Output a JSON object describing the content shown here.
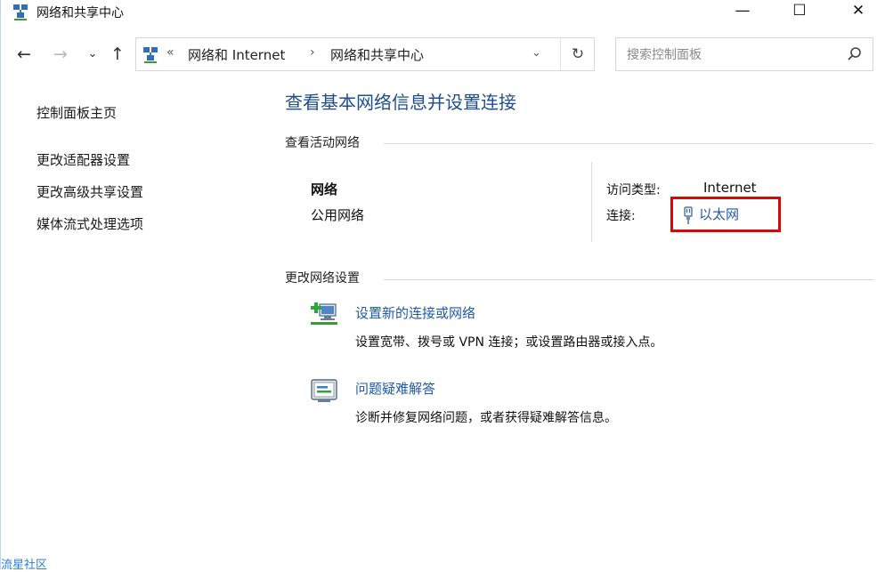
{
  "window": {
    "title": "网络和共享中心",
    "minimize_glyph": "—",
    "maximize_glyph": "☐",
    "close_glyph": "✕"
  },
  "nav": {
    "back": "←",
    "forward": "→",
    "recent": "⌄",
    "up": "↑"
  },
  "address": {
    "overflow": "«",
    "crumbs": [
      "网络和 Internet",
      "网络和共享中心"
    ],
    "separator": "›",
    "dropdown": "⌄",
    "refresh": "↻"
  },
  "search": {
    "placeholder": "搜索控制面板"
  },
  "sidebar": {
    "items": [
      {
        "label": "控制面板主页"
      },
      {
        "label": "更改适配器设置"
      },
      {
        "label": "更改高级共享设置"
      },
      {
        "label": "媒体流式处理选项"
      }
    ]
  },
  "main": {
    "title": "查看基本网络信息并设置连接",
    "active_networks": {
      "heading": "查看活动网络",
      "network_name": "网络",
      "network_type": "公用网络",
      "access_type_label": "访问类型:",
      "access_type_value": "Internet",
      "connections_label": "连接:",
      "connection_link": "以太网"
    },
    "change_settings": {
      "heading": "更改网络设置",
      "tasks": [
        {
          "link": "设置新的连接或网络",
          "desc": "设置宽带、拨号或 VPN 连接；或设置路由器或接入点。",
          "icon": "new-connection-icon"
        },
        {
          "link": "问题疑难解答",
          "desc": "诊断并修复网络问题，或者获得疑难解答信息。",
          "icon": "troubleshoot-icon"
        }
      ]
    }
  },
  "watermark": "流星社区",
  "colors": {
    "link": "#1e5aa8",
    "title": "#1e4e8c",
    "highlight_box": "#d10a0a"
  }
}
